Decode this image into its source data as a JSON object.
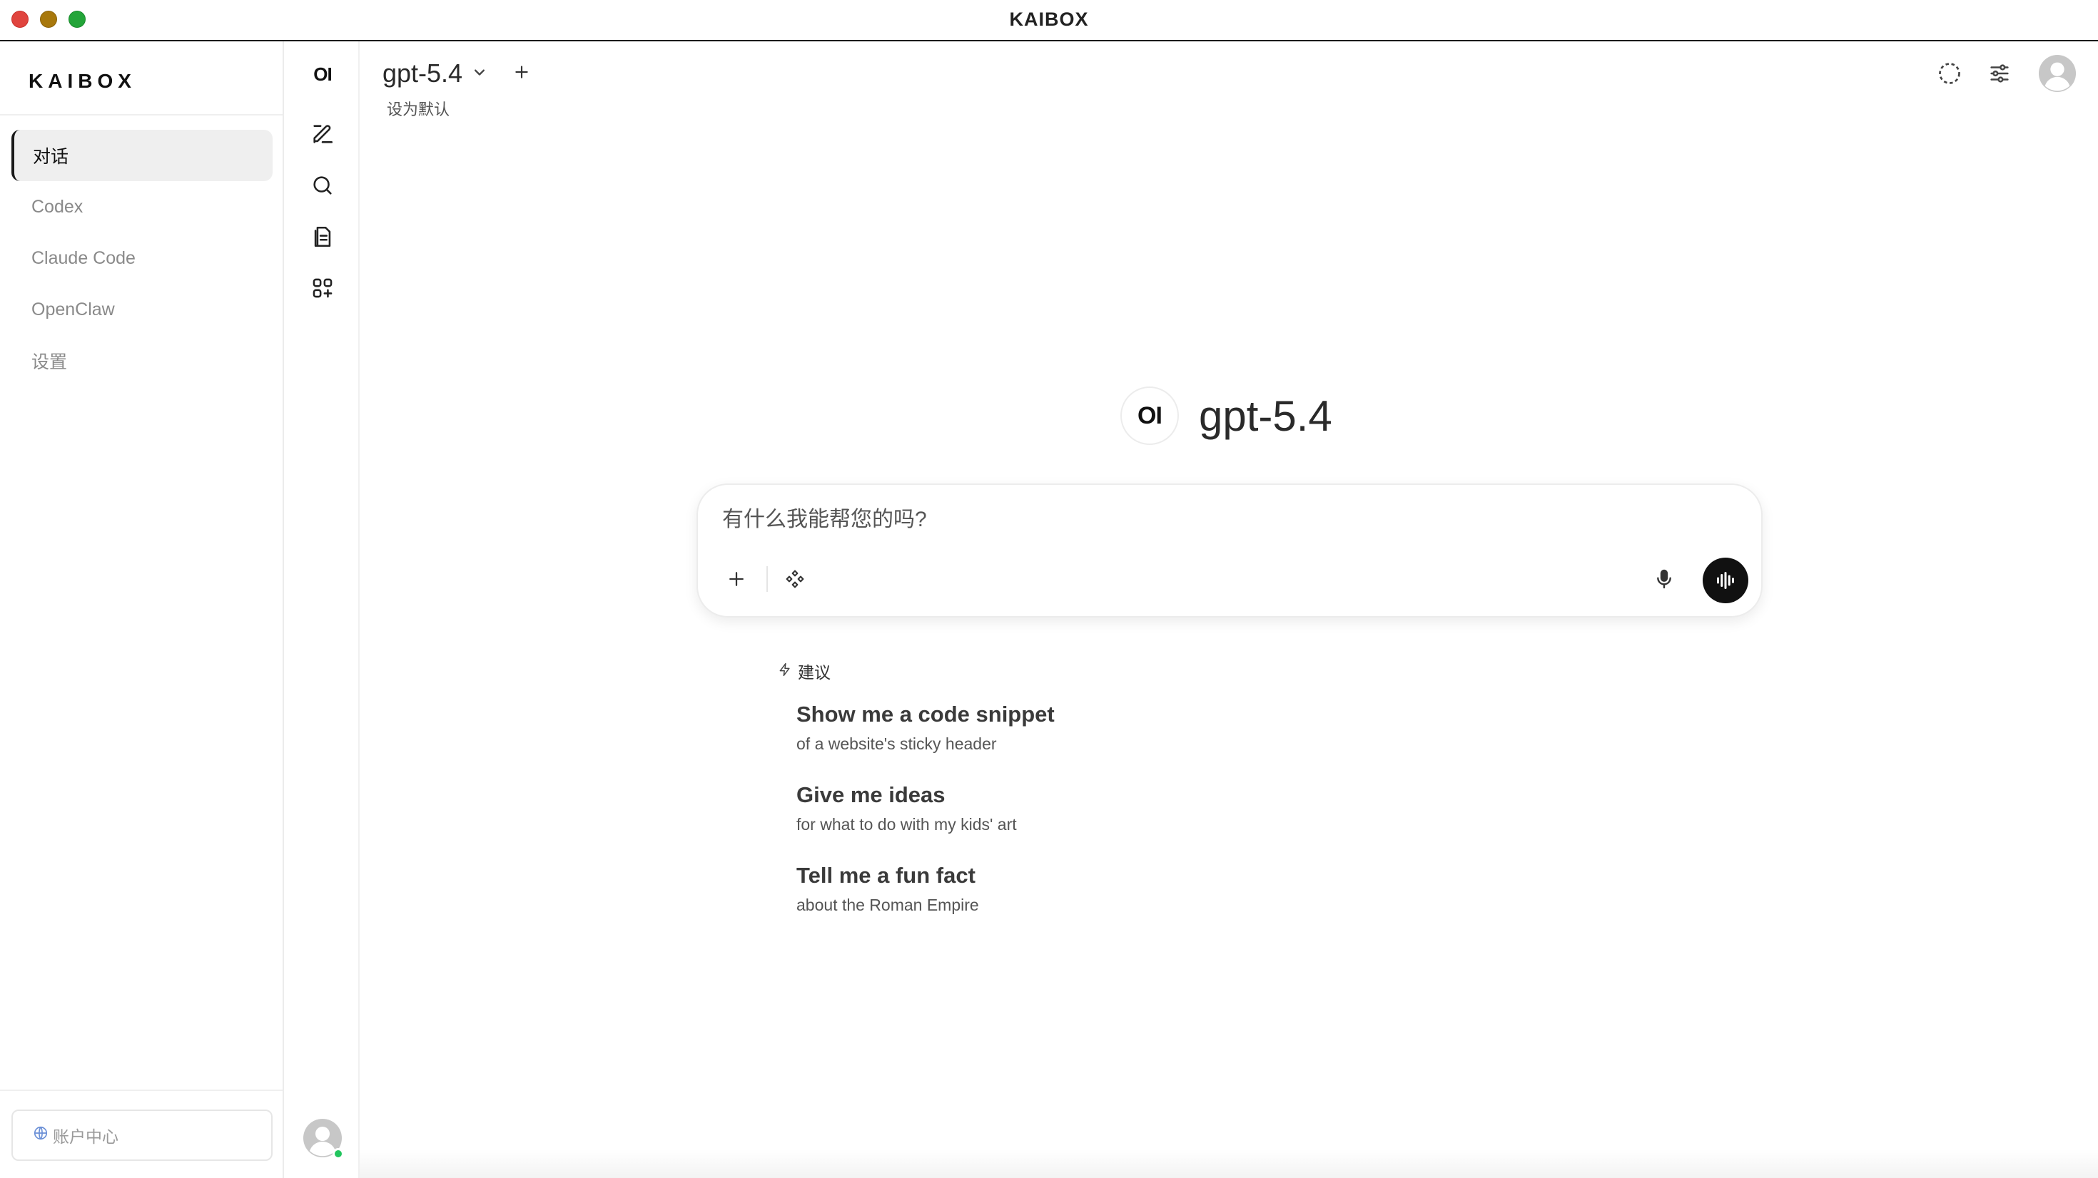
{
  "window": {
    "title": "KAIBOX"
  },
  "sidebar": {
    "brand": "KAIBOX",
    "items": [
      {
        "label": "对话",
        "active": true
      },
      {
        "label": "Codex",
        "active": false
      },
      {
        "label": "Claude Code",
        "active": false
      },
      {
        "label": "OpenClaw",
        "active": false
      },
      {
        "label": "设置",
        "active": false
      }
    ],
    "account_label": "账户中心",
    "account_icon": "globe-icon"
  },
  "rail": {
    "logo": "OI",
    "icons": [
      "new-chat-icon",
      "search-icon",
      "notes-icon",
      "apps-icon"
    ]
  },
  "header": {
    "model_name": "gpt-5.4",
    "set_default": "设为默认",
    "icons": [
      "dashed-circle-icon",
      "sliders-icon",
      "avatar-icon"
    ]
  },
  "hero": {
    "logo": "OI",
    "title": "gpt-5.4"
  },
  "composer": {
    "placeholder": "有什么我能帮您的吗?",
    "value": ""
  },
  "suggestions": {
    "header": "建议",
    "items": [
      {
        "title": "Show me a code snippet",
        "subtitle": "of a website's sticky header"
      },
      {
        "title": "Give me ideas",
        "subtitle": "for what to do with my kids' art"
      },
      {
        "title": "Tell me a fun fact",
        "subtitle": "about the Roman Empire"
      }
    ]
  },
  "colors": {
    "accent": "#111111",
    "online": "#22c55e",
    "active_nav_bg": "#efefef"
  }
}
